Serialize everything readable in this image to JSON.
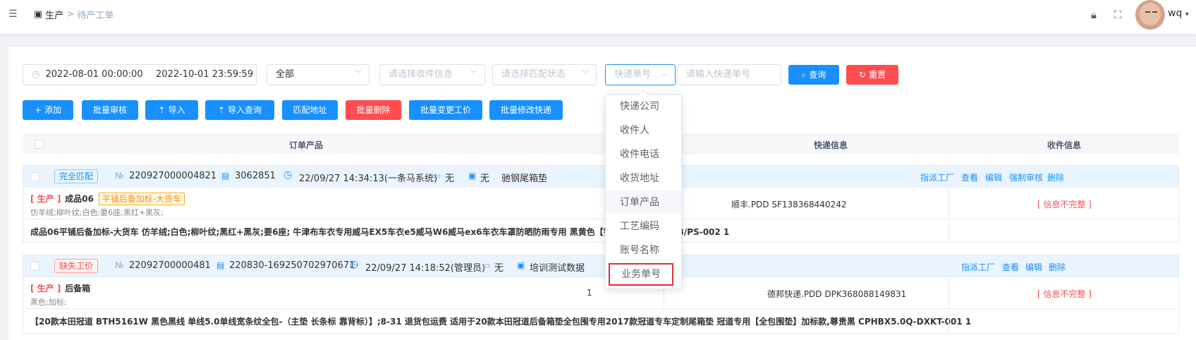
{
  "breadcrumb": {
    "level1": "生产",
    "separator": ">",
    "level2": "待产工单"
  },
  "user": {
    "name": "wq"
  },
  "filters": {
    "date_start": "2022-08-01 00:00:00",
    "date_end": "2022-10-01 23:59:59",
    "status_value": "全部",
    "receiver_placeholder": "请选择收件信息",
    "match_placeholder": "请选择匹配状态",
    "search_type_placeholder": "快递单号",
    "express_input_placeholder": "请输入快递单号",
    "query_label": "查询",
    "reset_label": "重置"
  },
  "actions": {
    "add": "添加",
    "batch_review": "批量审核",
    "import": "导入",
    "import_query": "导入查询",
    "match_address": "匹配地址",
    "batch_delete": "批量删除",
    "batch_change_process": "批量变更工价",
    "batch_modify_express": "批量修改快递"
  },
  "table": {
    "columns": [
      "订单产品",
      "快递信息",
      "收件信息"
    ]
  },
  "orders": [
    {
      "match_status": "完全匹配",
      "order_no": "220927000004821",
      "doc_no": "3062851",
      "time": "22/09/27 14:34:13(一条马系统)",
      "store": "无",
      "account": "无",
      "shop": "驰钢尾箱垫",
      "actions": [
        "指派工厂",
        "查看",
        "编辑",
        "强制审核",
        "删除"
      ],
      "tag": "[ 生产 ]",
      "product_name": "成品06",
      "product_tag": "平铺后备加标-大货车",
      "spec": "仿羊绒;柳叶纹;白色;要6座;黑红+黑灰;",
      "express": "顺丰.PDD SF138368440242",
      "receiver": "[ 信息不完整 ]",
      "detail": "成品06平铺后备加标-大货车 仿羊绒;白色;柳叶纹;黑红+黑灰;要6座; 牛津布车衣专用威马EX5车衣e5威马W6威马ex6车衣车罩防晒防雨专用 黑黄色【银盾牛津布】 D/NJB/PS-002 1"
    },
    {
      "match_status": "缺失工价",
      "order_no": "22092700000481",
      "doc_no": "220830-169250702970671",
      "time": "22/09/27 14:18:52(管理员)",
      "store": "无",
      "account": "培训测试数据",
      "actions": [
        "指派工厂",
        "查看",
        "编辑",
        "删除"
      ],
      "tag": "[ 生产 ]",
      "product_name": "后备箱",
      "spec": "黑色;加标;",
      "qty": "1",
      "express": "德邦快递.PDD DPK368088149831",
      "receiver": "[ 信息不完整 ]",
      "detail": "【20款本田冠道 BTH5161W 黑色黑线 单线5.0单线宽条纹全包-（主垫 长条标 靠背标）】;8-31 退货包运费 适用于20款本田冠道后备箱垫全包围专用2017款冠道专车定制尾箱垫 冠道专用【全包围垫】加标款,尊贵黑 CPHBX5.0Q-DXKT-001 1"
    }
  ],
  "dropdown": {
    "items": [
      "快递公司",
      "收件人",
      "收件电话",
      "收货地址",
      "订单产品",
      "工艺编码",
      "账号名称",
      "业务单号"
    ]
  },
  "colors": {
    "primary": "#1890ff",
    "danger": "#ff4d4f",
    "highlight_box": "#d9303a"
  }
}
